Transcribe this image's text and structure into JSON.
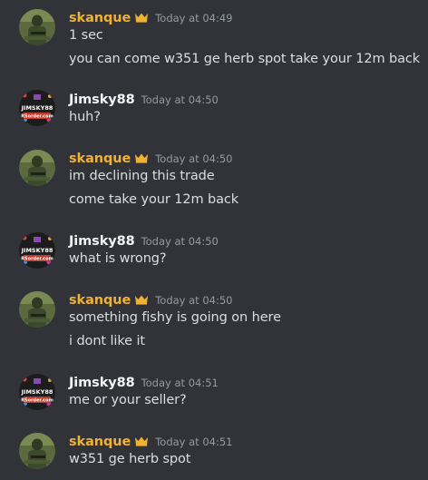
{
  "colors": {
    "background": "#313338",
    "skanque": "#f0b232",
    "jimsky": "#f2f3f5",
    "timestamp": "#949ba4",
    "text": "#dbdee1"
  },
  "messages": [
    {
      "author": "skanque",
      "crown_icon": "crown-icon",
      "avatar_icon": "soldier-avatar",
      "timestamp": "Today at 04:49",
      "lines": [
        "1 sec",
        "you can come w351 ge herb spot take your 12m back"
      ]
    },
    {
      "author": "Jimsky88",
      "avatar_icon": "jimsky88-rsorder-logo",
      "avatar_logo_text": [
        "JIMSKY88",
        "RSorder.com"
      ],
      "timestamp": "Today at 04:50",
      "lines": [
        "huh?"
      ]
    },
    {
      "author": "skanque",
      "crown_icon": "crown-icon",
      "avatar_icon": "soldier-avatar",
      "timestamp": "Today at 04:50",
      "lines": [
        "im declining this trade",
        "come take your 12m back"
      ]
    },
    {
      "author": "Jimsky88",
      "avatar_icon": "jimsky88-rsorder-logo",
      "avatar_logo_text": [
        "JIMSKY88",
        "RSorder.com"
      ],
      "timestamp": "Today at 04:50",
      "lines": [
        "what is wrong?"
      ]
    },
    {
      "author": "skanque",
      "crown_icon": "crown-icon",
      "avatar_icon": "soldier-avatar",
      "timestamp": "Today at 04:50",
      "lines": [
        "something fishy is going on here",
        "i dont like it"
      ]
    },
    {
      "author": "Jimsky88",
      "avatar_icon": "jimsky88-rsorder-logo",
      "avatar_logo_text": [
        "JIMSKY88",
        "RSorder.com"
      ],
      "timestamp": "Today at 04:51",
      "lines": [
        "me or your seller?"
      ]
    },
    {
      "author": "skanque",
      "crown_icon": "crown-icon",
      "avatar_icon": "soldier-avatar",
      "timestamp": "Today at 04:51",
      "lines": [
        "w351 ge herb spot"
      ]
    }
  ]
}
